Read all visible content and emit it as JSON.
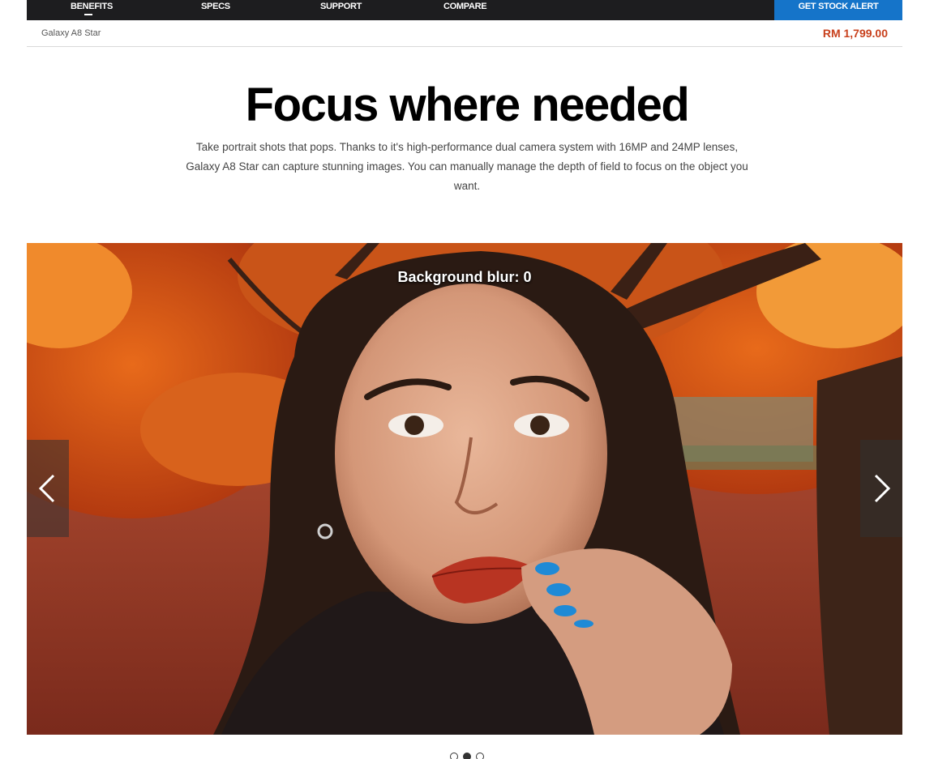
{
  "nav": {
    "items": [
      {
        "label": "BENEFITS",
        "active": true
      },
      {
        "label": "SPECS",
        "active": false
      },
      {
        "label": "SUPPORT",
        "active": false
      },
      {
        "label": "COMPARE",
        "active": false
      }
    ],
    "cta_label": "GET STOCK ALERT"
  },
  "product": {
    "name": "Galaxy A8 Star",
    "price": "RM 1,799.00"
  },
  "hero": {
    "headline": "Focus where needed",
    "description": "Take portrait shots that pops. Thanks to it's high-performance dual camera system with 16MP and 24MP lenses, Galaxy A8 Star can capture stunning images. You can manually manage the depth of field to focus on the object you want."
  },
  "carousel": {
    "overlay_label": "Background blur: 0",
    "prev_icon": "chevron-left-icon",
    "next_icon": "chevron-right-icon",
    "slide_count": 3,
    "active_slide": 2
  },
  "colors": {
    "nav_bg": "#1d1d1f",
    "cta_bg": "#1574c9",
    "price": "#c8401c"
  }
}
